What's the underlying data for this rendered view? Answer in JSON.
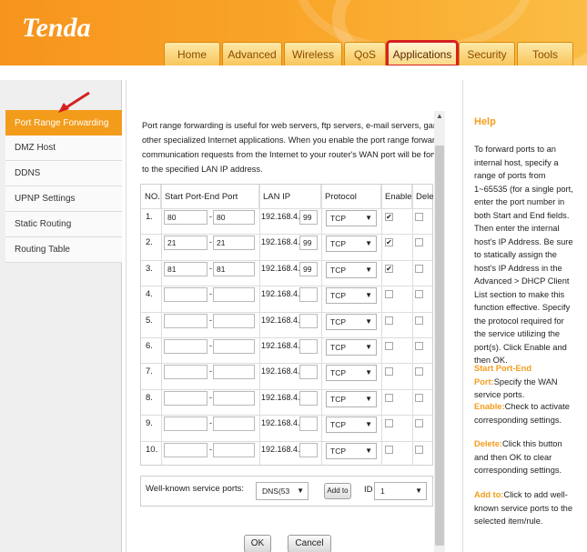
{
  "brand": {
    "logo": "Tenda"
  },
  "nav": {
    "tabs": [
      {
        "label": "Home"
      },
      {
        "label": "Advanced"
      },
      {
        "label": "Wireless"
      },
      {
        "label": "QoS"
      },
      {
        "label": "Applications"
      },
      {
        "label": "Security"
      },
      {
        "label": "Tools"
      }
    ],
    "active_tab": "Applications"
  },
  "sidebar": {
    "items": [
      {
        "label": "Port Range Forwarding"
      },
      {
        "label": "DMZ Host"
      },
      {
        "label": "DDNS"
      },
      {
        "label": "UPNP Settings"
      },
      {
        "label": "Static Routing"
      },
      {
        "label": "Routing Table"
      }
    ],
    "active": "Port Range Forwarding"
  },
  "main": {
    "description_lines": [
      "Port range forwarding is useful for web servers, ftp servers, e-mail servers, gaming a",
      "other specialized Internet applications. When you enable the port range forwarding, t",
      "communication requests from the Internet to your router's WAN port will be forwarde",
      "to the specified LAN IP address."
    ],
    "table": {
      "headers": {
        "no": "NO.",
        "ports": "Start Port-End Port",
        "lan_ip": "LAN IP",
        "protocol": "Protocol",
        "enable": "Enable",
        "delete": "Dele"
      },
      "rows": [
        {
          "no": "1.",
          "start": "80",
          "end": "80",
          "ip_prefix": "192.168.4.",
          "ip_last": "99",
          "protocol": "TCP",
          "enabled": true
        },
        {
          "no": "2.",
          "start": "21",
          "end": "21",
          "ip_prefix": "192.168.4.",
          "ip_last": "99",
          "protocol": "TCP",
          "enabled": true
        },
        {
          "no": "3.",
          "start": "81",
          "end": "81",
          "ip_prefix": "192.168.4.",
          "ip_last": "99",
          "protocol": "TCP",
          "enabled": true
        },
        {
          "no": "4.",
          "start": "",
          "end": "",
          "ip_prefix": "192.168.4.",
          "ip_last": "",
          "protocol": "TCP",
          "enabled": false
        },
        {
          "no": "5.",
          "start": "",
          "end": "",
          "ip_prefix": "192.168.4.",
          "ip_last": "",
          "protocol": "TCP",
          "enabled": false
        },
        {
          "no": "6.",
          "start": "",
          "end": "",
          "ip_prefix": "192.168.4.",
          "ip_last": "",
          "protocol": "TCP",
          "enabled": false
        },
        {
          "no": "7.",
          "start": "",
          "end": "",
          "ip_prefix": "192.168.4.",
          "ip_last": "",
          "protocol": "TCP",
          "enabled": false
        },
        {
          "no": "8.",
          "start": "",
          "end": "",
          "ip_prefix": "192.168.4.",
          "ip_last": "",
          "protocol": "TCP",
          "enabled": false
        },
        {
          "no": "9.",
          "start": "",
          "end": "",
          "ip_prefix": "192.168.4.",
          "ip_last": "",
          "protocol": "TCP",
          "enabled": false
        },
        {
          "no": "10.",
          "start": "",
          "end": "",
          "ip_prefix": "192.168.4.",
          "ip_last": "",
          "protocol": "TCP",
          "enabled": false
        }
      ],
      "dash": "-"
    },
    "well_known": {
      "label": "Well-known service ports:",
      "service_value": "DNS(53",
      "add_label": "Add to",
      "id_label": "ID",
      "id_value": "1"
    },
    "ok_label": "OK",
    "cancel_label": "Cancel"
  },
  "help": {
    "title": "Help",
    "intro": "To forward ports to an internal host, specify a range of ports from 1~65535 (for a single port, enter the port number in both Start and End fields. Then enter the internal host's IP Address. Be sure to statically assign the host's IP Address in the Advanced > DHCP Client List section to make this function effective. Specify the protocol required for the service utilizing the port(s). Click Enable and then OK.",
    "items": [
      {
        "term": "Start Port-End Port:",
        "text": "Specify the WAN service ports."
      },
      {
        "term": "Enable:",
        "text": "Check to activate corresponding settings."
      },
      {
        "term": "Delete:",
        "text": "Click this button and then OK to clear corresponding settings."
      },
      {
        "term": "Add to:",
        "text": "Click to add well-known service ports to the selected item/rule."
      }
    ]
  },
  "colors": {
    "accent": "#f39c1b",
    "highlight_box": "#d62020",
    "header": "#f7941d"
  },
  "icons": {
    "caret": "chevron-down-icon",
    "check": "check-icon",
    "arrow": "pointer-arrow-icon"
  }
}
